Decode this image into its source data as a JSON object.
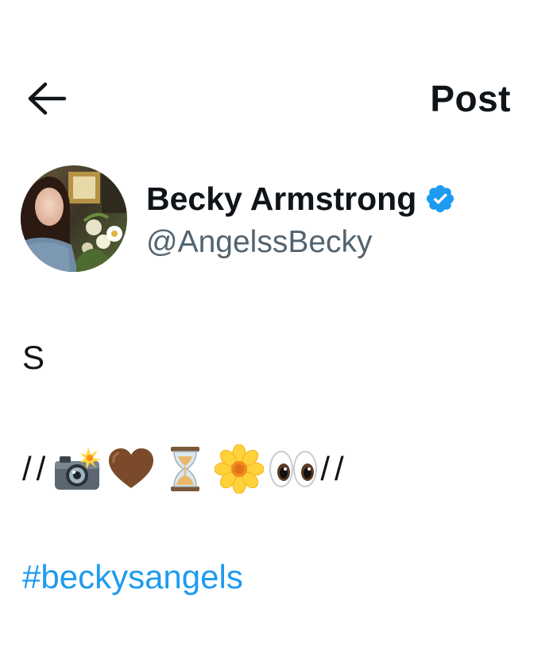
{
  "header": {
    "title": "Post",
    "back_icon": "arrow-left-icon"
  },
  "author": {
    "display_name": "Becky Armstrong",
    "handle": "@AngelssBecky",
    "verified_icon": "verified-badge-icon",
    "verified_color": "#1d9bf0"
  },
  "tweet": {
    "line1": "S",
    "line2_prefix": "//",
    "line2_suffix": "//",
    "emojis": [
      "camera-flash-icon",
      "brown-heart-icon",
      "hourglass-icon",
      "blossom-icon",
      "eyes-icon"
    ],
    "hashtag": "#beckysangels",
    "hashtag_color": "#1d9bf0"
  }
}
